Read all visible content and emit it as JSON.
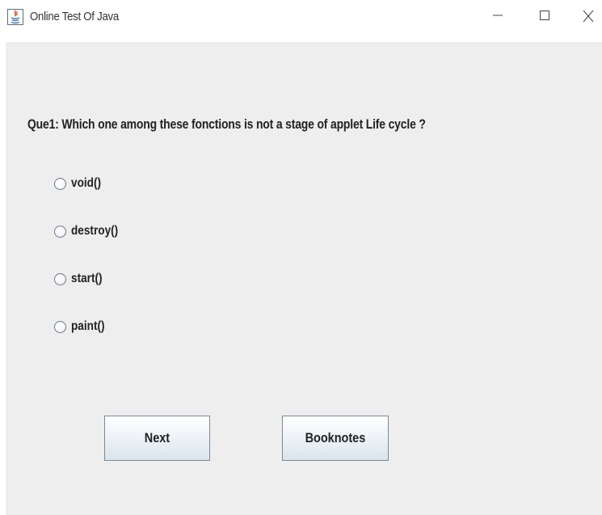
{
  "window": {
    "title": "Online Test Of Java",
    "icon": "java-icon"
  },
  "question": {
    "text": "Que1: Which one among these fonctions is not a stage of applet Life cycle ?"
  },
  "options": [
    {
      "label": "void()",
      "selected": false
    },
    {
      "label": "destroy()",
      "selected": false
    },
    {
      "label": "start()",
      "selected": false
    },
    {
      "label": "paint()",
      "selected": false
    }
  ],
  "buttons": {
    "next_label": "Next",
    "booknotes_label": "Booknotes"
  }
}
